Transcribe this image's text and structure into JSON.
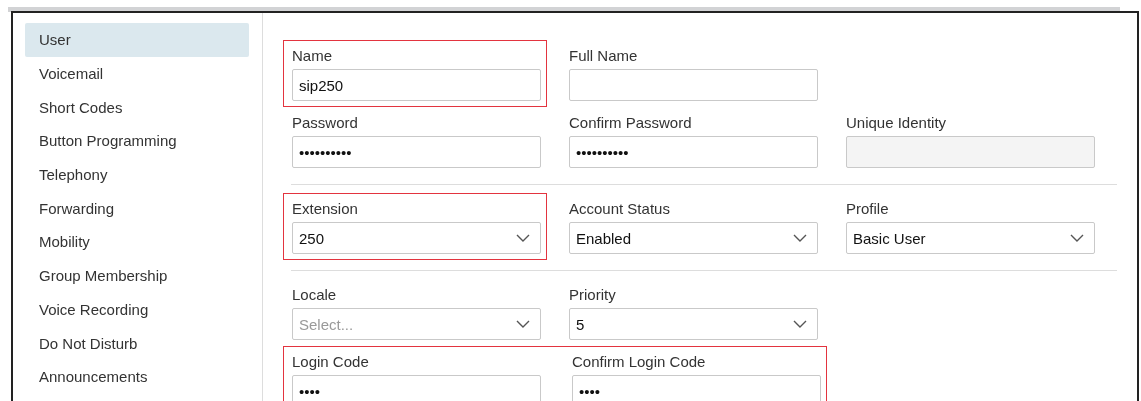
{
  "sidebar": {
    "items": [
      {
        "label": "User",
        "selected": true
      },
      {
        "label": "Voicemail",
        "selected": false
      },
      {
        "label": "Short Codes",
        "selected": false
      },
      {
        "label": "Button Programming",
        "selected": false
      },
      {
        "label": "Telephony",
        "selected": false
      },
      {
        "label": "Forwarding",
        "selected": false
      },
      {
        "label": "Mobility",
        "selected": false
      },
      {
        "label": "Group Membership",
        "selected": false
      },
      {
        "label": "Voice Recording",
        "selected": false
      },
      {
        "label": "Do Not Disturb",
        "selected": false
      },
      {
        "label": "Announcements",
        "selected": false
      }
    ]
  },
  "form": {
    "sections": [
      {
        "rows": [
          {
            "groups": [
              {
                "highlighted": true,
                "fields": [
                  {
                    "label": "Name",
                    "kind": "text",
                    "value": "sip250"
                  }
                ]
              },
              {
                "highlighted": false,
                "fields": [
                  {
                    "label": "Full Name",
                    "kind": "text"
                  }
                ]
              }
            ]
          },
          {
            "groups": [
              {
                "highlighted": false,
                "fields": [
                  {
                    "label": "Password",
                    "kind": "text",
                    "value": "••••••••••"
                  }
                ]
              },
              {
                "highlighted": false,
                "fields": [
                  {
                    "label": "Confirm Password",
                    "kind": "text",
                    "value": "••••••••••"
                  }
                ]
              },
              {
                "highlighted": false,
                "fields": [
                  {
                    "label": "Unique Identity",
                    "kind": "readonly"
                  }
                ]
              }
            ]
          }
        ]
      },
      {
        "rows": [
          {
            "groups": [
              {
                "highlighted": true,
                "fields": [
                  {
                    "label": "Extension",
                    "kind": "select",
                    "value": "250"
                  }
                ]
              },
              {
                "highlighted": false,
                "fields": [
                  {
                    "label": "Account Status",
                    "kind": "select",
                    "value": "Enabled"
                  }
                ]
              },
              {
                "highlighted": false,
                "fields": [
                  {
                    "label": "Profile",
                    "kind": "select",
                    "value": "Basic User"
                  }
                ]
              }
            ]
          }
        ]
      },
      {
        "rows": [
          {
            "groups": [
              {
                "highlighted": false,
                "fields": [
                  {
                    "label": "Locale",
                    "kind": "select",
                    "placeholder": "Select..."
                  }
                ]
              },
              {
                "highlighted": false,
                "fields": [
                  {
                    "label": "Priority",
                    "kind": "select",
                    "value": "5"
                  }
                ]
              }
            ]
          },
          {
            "groups": [
              {
                "highlighted": true,
                "fields": [
                  {
                    "label": "Login Code",
                    "kind": "text",
                    "value": "••••"
                  },
                  {
                    "label": "Confirm Login Code",
                    "kind": "text",
                    "value": "••••"
                  }
                ]
              }
            ]
          }
        ]
      }
    ]
  }
}
